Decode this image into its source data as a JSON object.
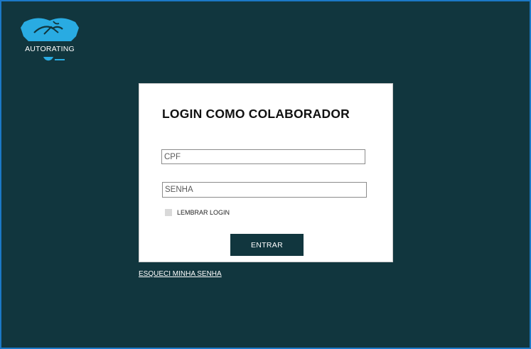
{
  "logo": {
    "text": "AUTORATING",
    "icon": "handshake-icon",
    "color": "#29abe2"
  },
  "login": {
    "title": "LOGIN COMO COLABORADOR",
    "cpf_placeholder": "CPF",
    "password_placeholder": "SENHA",
    "remember_label": "LEMBRAR LOGIN",
    "submit_label": "ENTRAR",
    "forgot_label": "ESQUECI MINHA SENHA"
  },
  "colors": {
    "background": "#11363e",
    "card": "#ffffff",
    "accent": "#29abe2",
    "border": "#1b78c6"
  }
}
